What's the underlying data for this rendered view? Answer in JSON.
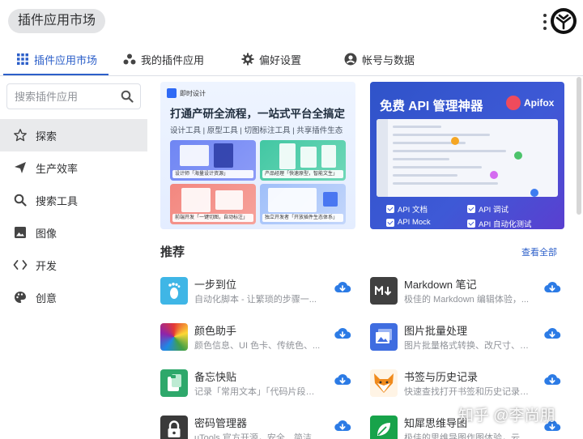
{
  "app": {
    "title": "插件应用市场"
  },
  "tabs": [
    {
      "label": "插件应用市场",
      "icon": "grid-icon"
    },
    {
      "label": "我的插件应用",
      "icon": "dots-cluster-icon"
    },
    {
      "label": "偏好设置",
      "icon": "gear-icon"
    },
    {
      "label": "帐号与数据",
      "icon": "account-icon"
    }
  ],
  "search": {
    "placeholder": "搜索插件应用"
  },
  "sidebar": {
    "items": [
      {
        "label": "探索",
        "icon": "star-icon",
        "active": true
      },
      {
        "label": "生产效率",
        "icon": "send-icon",
        "active": false
      },
      {
        "label": "搜索工具",
        "icon": "search-icon",
        "active": false
      },
      {
        "label": "图像",
        "icon": "image-icon",
        "active": false
      },
      {
        "label": "开发",
        "icon": "code-icon",
        "active": false
      },
      {
        "label": "创意",
        "icon": "palette-icon",
        "active": false
      }
    ]
  },
  "banners": {
    "left": {
      "brand": "即时设计",
      "title": "打通产研全流程，一站式平台全搞定",
      "subtitle": "设计工具 | 原型工具 | 切图标注工具 | 共享插件生态",
      "cards": [
        "设计师「海量设计资源」",
        "产品经理「快速原型，智能文生」",
        "前端开发「一键切图，自动标注」",
        "独立开发者「开放插件生态体系」"
      ]
    },
    "right": {
      "title": "免费 API 管理神器",
      "logo": "Apifox",
      "features": [
        "API 文档",
        "API 调试",
        "API Mock",
        "API 自动化测试"
      ]
    }
  },
  "recommend": {
    "title": "推荐",
    "view_all": "查看全部",
    "plugins": [
      {
        "name": "一步到位",
        "desc": "自动化脚本 - 让繁琐的步骤一...",
        "icon": "footprint-icon",
        "color": "#3fb6e6"
      },
      {
        "name": "Markdown 笔记",
        "desc": "极佳的 Markdown 编辑体验，...",
        "icon": "markdown-icon",
        "color": "#404040"
      },
      {
        "name": "颜色助手",
        "desc": "颜色信息、UI 色卡、传统色、...",
        "icon": "color-palette-icon",
        "color": "#e04e4e"
      },
      {
        "name": "图片批量处理",
        "desc": "图片批量格式转换、改尺寸、裁...",
        "icon": "image-batch-icon",
        "color": "#3f6de0"
      },
      {
        "name": "备忘快贴",
        "desc": "记录「常用文本」「代码片段」「图...",
        "icon": "clipboard-icon",
        "color": "#2ea86b"
      },
      {
        "name": "书签与历史记录",
        "desc": "快速查找打开书签和历史记录，...",
        "icon": "fox-icon",
        "color": "#f08a1c"
      },
      {
        "name": "密码管理器",
        "desc": "uTools 官方开源，安全、简洁...",
        "icon": "lock-icon",
        "color": "#3a3a3a"
      },
      {
        "name": "知犀思维导图",
        "desc": "极佳的思维导图作图体验，云端...",
        "icon": "mindmap-icon",
        "color": "#17a34a"
      }
    ]
  },
  "watermark": "知乎 @李尚朋"
}
